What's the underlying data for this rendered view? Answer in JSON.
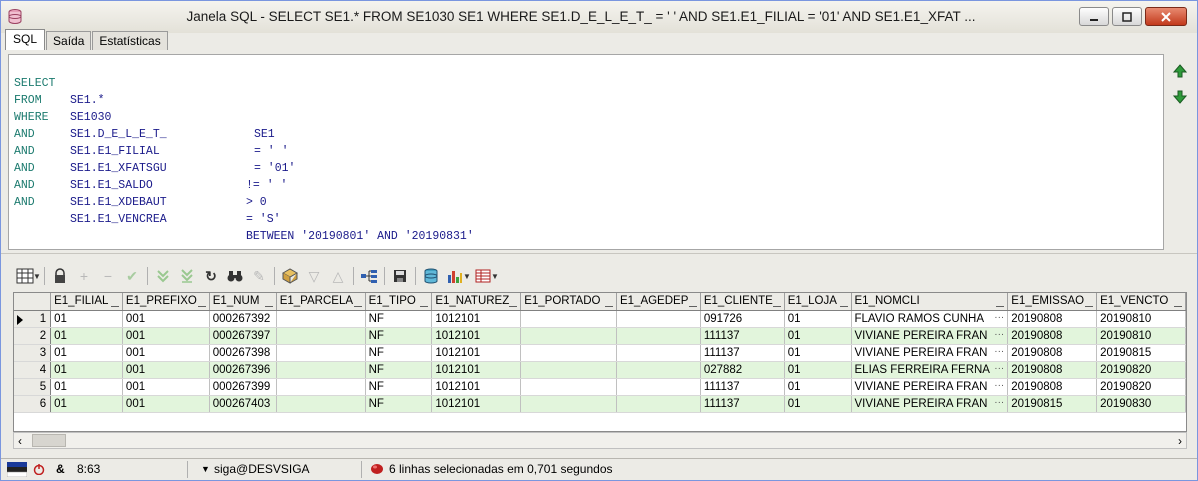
{
  "window": {
    "title": "Janela SQL - SELECT SE1.* FROM SE1030 SE1 WHERE SE1.D_E_L_E_T_ = ' ' AND SE1.E1_FILIAL = '01' AND SE1.E1_XFAT ..."
  },
  "tabs": [
    {
      "label": "SQL"
    },
    {
      "label": "Saída"
    },
    {
      "label": "Estatísticas"
    }
  ],
  "sql": [
    {
      "kw": "SELECT",
      "field": "SE1.*",
      "op": ""
    },
    {
      "kw": "FROM",
      "field": "SE1030",
      "op": "SE1"
    },
    {
      "kw": "WHERE",
      "field": "SE1.D_E_L_E_T_",
      "op": "= ' '"
    },
    {
      "kw": "AND",
      "field": "SE1.E1_FILIAL",
      "op": "= '01'"
    },
    {
      "kw": "AND",
      "field": "SE1.E1_XFATSGU",
      "op": "!= ' '"
    },
    {
      "kw": "AND",
      "field": "SE1.E1_SALDO",
      "op": "> 0"
    },
    {
      "kw": "AND",
      "field": "SE1.E1_XDEBAUT",
      "op": "= 'S'"
    },
    {
      "kw": "AND",
      "field": "SE1.E1_VENCREA",
      "op": "BETWEEN '20190801' AND '20190831'"
    }
  ],
  "grid": {
    "columns": [
      "E1_FILIAL",
      "E1_PREFIXO",
      "E1_NUM",
      "E1_PARCELA",
      "E1_TIPO",
      "E1_NATUREZ",
      "E1_PORTADO",
      "E1_AGEDEP",
      "E1_CLIENTE",
      "E1_LOJA",
      "E1_NOMCLI",
      "E1_EMISSAO",
      "E1_VENCTO"
    ],
    "rows": [
      {
        "n": "1",
        "cells": [
          "01",
          "001",
          "000267392",
          "",
          "NF",
          "1012101",
          "",
          "",
          "091726",
          "01",
          "FLAVIO RAMOS CUNHA",
          "20190808",
          "20190810"
        ]
      },
      {
        "n": "2",
        "cells": [
          "01",
          "001",
          "000267397",
          "",
          "NF",
          "1012101",
          "",
          "",
          "111137",
          "01",
          "VIVIANE PEREIRA FRAN",
          "20190808",
          "20190810"
        ]
      },
      {
        "n": "3",
        "cells": [
          "01",
          "001",
          "000267398",
          "",
          "NF",
          "1012101",
          "",
          "",
          "111137",
          "01",
          "VIVIANE PEREIRA FRAN",
          "20190808",
          "20190815"
        ]
      },
      {
        "n": "4",
        "cells": [
          "01",
          "001",
          "000267396",
          "",
          "NF",
          "1012101",
          "",
          "",
          "027882",
          "01",
          "ELIAS FERREIRA FERNA",
          "20190808",
          "20190820"
        ]
      },
      {
        "n": "5",
        "cells": [
          "01",
          "001",
          "000267399",
          "",
          "NF",
          "1012101",
          "",
          "",
          "111137",
          "01",
          "VIVIANE PEREIRA FRAN",
          "20190808",
          "20190820"
        ]
      },
      {
        "n": "6",
        "cells": [
          "01",
          "001",
          "000267403",
          "",
          "NF",
          "1012101",
          "",
          "",
          "111137",
          "01",
          "VIVIANE PEREIRA FRAN",
          "20190815",
          "20190830"
        ]
      }
    ],
    "ellipsis": "···"
  },
  "status": {
    "symbol": "&",
    "position": "8:63",
    "connection": "siga@DESVSIGA",
    "message": "6 linhas selecionadas em 0,701 segundos"
  },
  "colors": {
    "alt_row": "#e2f5dc",
    "keyword": "#1b7a6e",
    "identifier": "#1a1a8a"
  }
}
